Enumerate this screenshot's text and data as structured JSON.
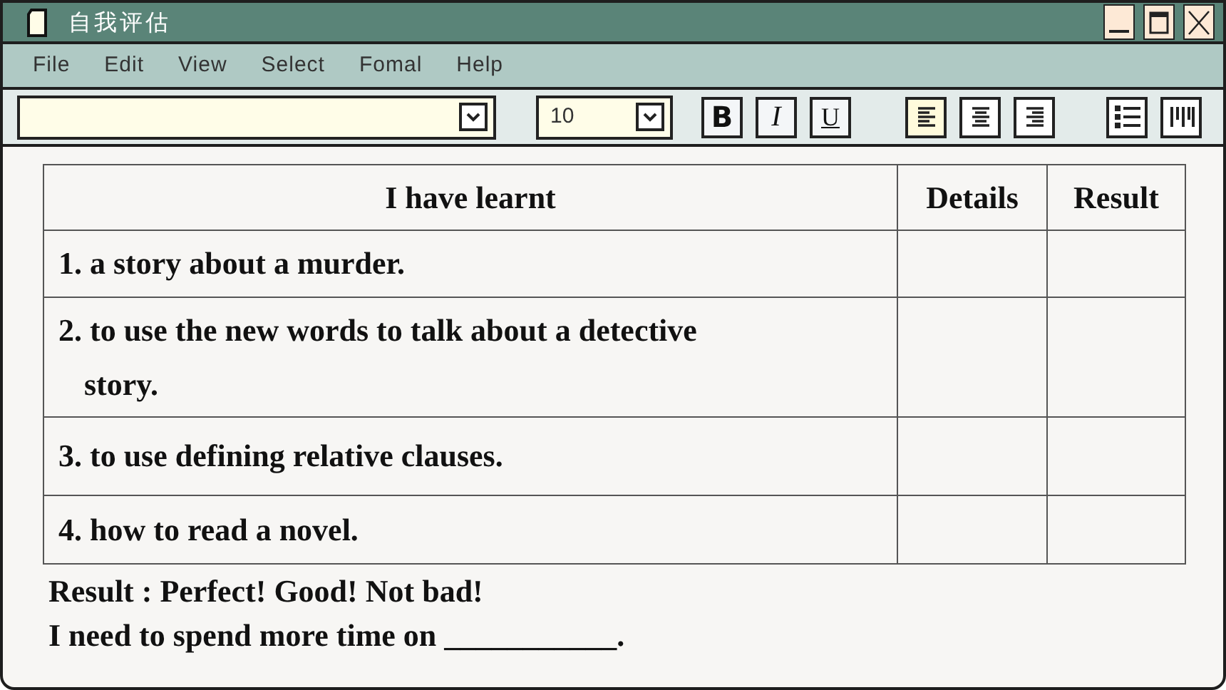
{
  "window": {
    "title": "自我评估"
  },
  "menu": [
    "File",
    "Edit",
    "View",
    "Select",
    "Fomal",
    "Help"
  ],
  "toolbar": {
    "font_size": "10",
    "format_buttons": [
      {
        "kind": "bold",
        "label": "B"
      },
      {
        "kind": "italic",
        "label": "I"
      },
      {
        "kind": "underline",
        "label": "U"
      }
    ],
    "align_buttons": [
      {
        "kind": "left",
        "selected": true
      },
      {
        "kind": "center",
        "selected": false
      },
      {
        "kind": "right",
        "selected": false
      }
    ]
  },
  "table": {
    "columns": [
      "I have learnt",
      "Details",
      "Result"
    ],
    "rows": [
      {
        "item": "1. a story about a murder."
      },
      {
        "item": "2. to use the new words to talk about a detective story."
      },
      {
        "item": "3. to use defining relative clauses."
      },
      {
        "item": "4. how to read a novel."
      }
    ]
  },
  "result_line": "Result : Perfect! Good! Not bad!",
  "prompt_line": "I need to spend more time on ___________."
}
